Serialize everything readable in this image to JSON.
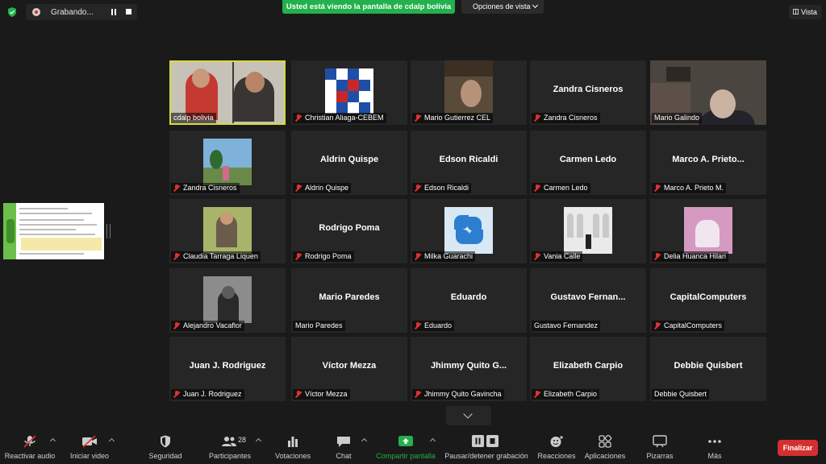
{
  "topbar": {
    "recording_label": "Grabando...",
    "share_banner": "Usted está viendo la pantalla de cdalp bolivia",
    "view_options": "Opciones de vista",
    "view_button": "Vista"
  },
  "tiles": [
    {
      "label": "cdalp bolivia",
      "muted": false
    },
    {
      "label": "Christian Aliaga-CEBEM",
      "muted": true
    },
    {
      "label": "Mario Gutierrez CEL",
      "muted": true
    },
    {
      "name": "Zandra Cisneros",
      "label": "Zandra Cisneros",
      "muted": true
    },
    {
      "label": "Mario Galindo",
      "muted": false
    },
    {
      "label": "Zandra Cisneros",
      "muted": true
    },
    {
      "name": "Aldrin Quispe",
      "label": "Aldrin Quispe",
      "muted": true
    },
    {
      "name": "Edson Ricaldi",
      "label": "Edson Ricaldi",
      "muted": true
    },
    {
      "name": "Carmen Ledo",
      "label": "Carmen Ledo",
      "muted": true
    },
    {
      "name": "Marco A. Prieto...",
      "label": "Marco A. Prieto M.",
      "muted": true
    },
    {
      "label": "Claudia Tarraga Liquen",
      "muted": true
    },
    {
      "name": "Rodrigo Poma",
      "label": "Rodrigo Poma",
      "muted": true
    },
    {
      "label": "Milka Guarachi",
      "muted": true
    },
    {
      "label": "Vania Calle",
      "muted": true
    },
    {
      "label": "Delia Huanca Hilari",
      "muted": true
    },
    {
      "label": "Alejandro Vacaflor",
      "muted": true
    },
    {
      "name": "Mario Paredes",
      "label": "Mario Paredes",
      "muted": false
    },
    {
      "name": "Eduardo",
      "label": "Eduardo",
      "muted": true
    },
    {
      "name": "Gustavo Fernan...",
      "label": "Gustavo Fernandez",
      "muted": false
    },
    {
      "name": "CapitalComputers",
      "label": "CapitalComputers",
      "muted": true
    },
    {
      "name": "Juan J. Rodriguez",
      "label": "Juan J. Rodriguez",
      "muted": true
    },
    {
      "name": "Víctor Mezza",
      "label": "Víctor Mezza",
      "muted": true
    },
    {
      "name": "Jhimmy Quito G...",
      "label": "Jhimmy Quito Gavincha",
      "muted": true
    },
    {
      "name": "Elizabeth Carpio",
      "label": "Elizabeth Carpio",
      "muted": true
    },
    {
      "name": "Debbie Quisbert",
      "label": "Debbie Quisbert",
      "muted": false
    }
  ],
  "toolbar": {
    "unmute": "Reactivar audio",
    "start_video": "Iniciar video",
    "security": "Seguridad",
    "participants": "Participantes",
    "participants_count": "28",
    "polls": "Votaciones",
    "chat": "Chat",
    "share": "Compartir pantalla",
    "record": "Pausar/detener grabación",
    "reactions": "Reacciones",
    "apps": "Aplicaciones",
    "whiteboards": "Pizarras",
    "more": "Más",
    "end": "Finalizar"
  }
}
